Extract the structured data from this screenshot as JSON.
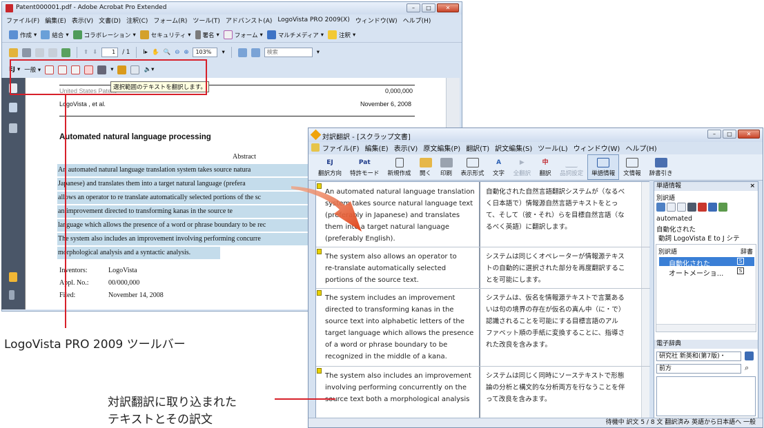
{
  "acrobat": {
    "title": "Patent000001.pdf - Adobe Acrobat Pro Extended",
    "menu": [
      "ファイル(F)",
      "編集(E)",
      "表示(V)",
      "文書(D)",
      "注釈(C)",
      "フォーム(R)",
      "ツール(T)",
      "アドバンスト(A)",
      "LogoVista PRO 2009(X)",
      "ウィンドウ(W)",
      "ヘルプ(H)"
    ],
    "toolbar1": [
      "作成",
      "結合",
      "コラボレーション",
      "セキュリティ",
      "署名",
      "フォーム",
      "マルチメディア",
      "注釈"
    ],
    "page_current": "1",
    "page_total": "/ 1",
    "zoom": "103%",
    "search_placeholder": "検索",
    "lv_toolbar": {
      "ej": "EJ",
      "general": "一般"
    },
    "tooltip": "選択範囲のテキストを翻訳します。",
    "doc": {
      "patent_label": "United States Patent",
      "patent_no": "0,000,000",
      "company": "LogoVista , et al.",
      "date": "November 6, 2008",
      "heading": "Automated natural language processing",
      "abstract_label": "Abstract",
      "lines": [
        "An automated natural language translation system takes source natura",
        "Japanese) and translates them into a target natural language (prefera",
        "allows an operator to re translate automatically selected portions of the sc",
        "an improvement directed to transforming kanas in the source te",
        "language which allows the presence of a word or phrase boundary to be rec",
        "The system also includes an improvement involving performing concurre",
        "morphological analysis and a syntactic analysis."
      ],
      "inventors_label": "Inventors:",
      "inventors": "LogoVista",
      "appl_label": "Appl. No.:",
      "appl": "00/000,000",
      "filed_label": "Filed:",
      "filed": "November 14, 2008"
    }
  },
  "labels": {
    "toolbar_label": "LogoVista PRO 2009 ツールバー",
    "taiyaku_label_1": "対訳翻訳に取り込まれた",
    "taiyaku_label_2": "テキストとその訳文"
  },
  "taiyaku": {
    "title": "対訳翻訳 - [スクラップ文書]",
    "menu": [
      "ファイル(F)",
      "編集(E)",
      "表示(V)",
      "原文編集(P)",
      "翻訳(T)",
      "訳文編集(S)",
      "ツール(L)",
      "ウィンドウ(W)",
      "ヘルプ(H)"
    ],
    "toolbar": [
      {
        "icon": "EJ",
        "label": "翻訳方向"
      },
      {
        "icon": "Pat",
        "label": "特許モード"
      },
      {
        "icon": "",
        "label": "新規作成"
      },
      {
        "icon": "",
        "label": "開く"
      },
      {
        "icon": "",
        "label": "印刷"
      },
      {
        "icon": "",
        "label": "表示形式"
      },
      {
        "icon": "",
        "label": "文字"
      },
      {
        "icon": "",
        "label": "全翻訳"
      },
      {
        "icon": "",
        "label": "翻訳"
      },
      {
        "icon": "",
        "label": "品詞設定"
      },
      {
        "icon": "",
        "label": "単語情報"
      },
      {
        "icon": "",
        "label": "文情報"
      },
      {
        "icon": "",
        "label": "辞書引き"
      }
    ],
    "segments": [
      {
        "en": [
          "An automated natural language translation",
          "system takes source natural language text",
          "(preferably in Japanese) and translates",
          "them into a target natural language",
          "(preferably English)."
        ],
        "ja": [
          "自動化された自然言語翻訳システムが（なるべ",
          "く日本語で）情報源自然言語テキストをとっ",
          "て、そして（彼・それ）らを目標自然言語（な",
          "るべく英語）に翻訳します。"
        ]
      },
      {
        "en": [
          "The system also allows an operator to",
          "re-translate automatically selected",
          "portions of the source text."
        ],
        "ja": [
          "システムは同じくオペレーターが情報源テキス",
          "トの自動的に選択された部分を再度翻訳するこ",
          "とを可能にします。"
        ]
      },
      {
        "en": [
          "The system includes an improvement",
          "directed to transforming kanas in the",
          "source text into alphabetic letters of the",
          "target language which allows the presence",
          "of a word or phrase boundary to be",
          "recognized in the middle of a kana."
        ],
        "ja": [
          "システムは、仮名を情報源テキストで言葉ある",
          "いは句の境界の存在が仮名の真ん中（に・で）",
          "認識されることを可能にする目標言語のアル",
          "ファベット順の手紙に変換することに、指導さ",
          "れた改良を含みます。"
        ]
      },
      {
        "en": [
          "The system also includes an improvement",
          "involving performing concurrently on the",
          "source text both a morphological analysis"
        ],
        "ja": [
          "システムは同じく同時にソーステキストで形態",
          "論の分析と構文的な分析両方を行なうことを伴",
          "って改良を含みます。"
        ]
      }
    ],
    "side": {
      "header": "単語情報",
      "sub": "別訳語",
      "word": "automated",
      "translation": "自動化された",
      "pos": "動詞  LogoVista E to J シテ",
      "col1": "別訳語",
      "col2": "辞書",
      "alts": [
        "自動化された",
        "オートメーショ..."
      ],
      "dict_header": "電子辞典",
      "dict_select": "研究社 新英和(第7版)・",
      "dict_dir": "前方"
    },
    "status": "待機中  訳文  5 / 8 文  翻訳済み  英語から日本語へ  一般"
  }
}
